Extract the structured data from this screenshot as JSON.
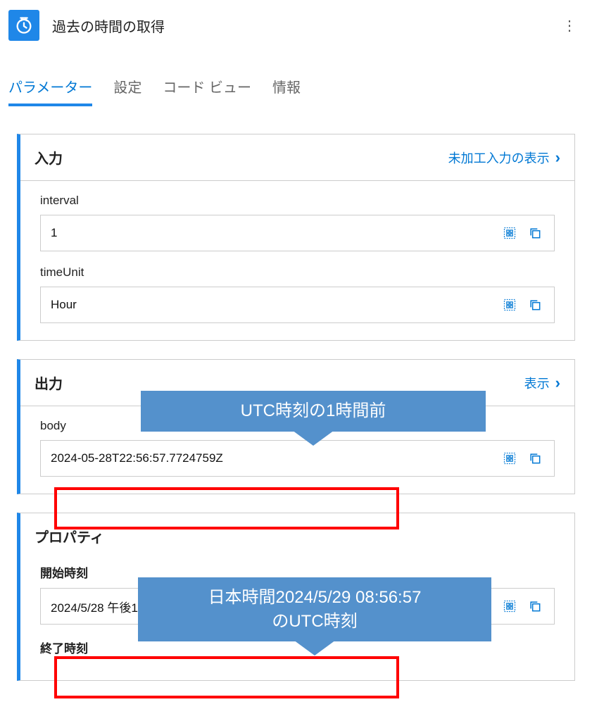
{
  "header": {
    "title": "過去の時間の取得"
  },
  "tabs": [
    {
      "label": "パラメーター",
      "active": true
    },
    {
      "label": "設定",
      "active": false
    },
    {
      "label": "コード ビュー",
      "active": false
    },
    {
      "label": "情報",
      "active": false
    }
  ],
  "cards": {
    "input": {
      "title": "入力",
      "rawLink": "未加工入力の表示",
      "fields": [
        {
          "label": "interval",
          "value": "1"
        },
        {
          "label": "timeUnit",
          "value": "Hour"
        }
      ]
    },
    "output": {
      "title": "出力",
      "rawLinkSuffix": "表示",
      "fields": [
        {
          "label": "body",
          "value": "2024-05-28T22:56:57.7724759Z"
        }
      ]
    },
    "property": {
      "title": "プロパティ",
      "fields": [
        {
          "label": "開始時刻",
          "value": "2024/5/28 午後11:56:57"
        },
        {
          "label": "終了時刻",
          "value": ""
        }
      ]
    }
  },
  "annotations": {
    "callout1": "UTC時刻の1時間前",
    "callout2": "日本時間2024/5/29 08:56:57\nのUTC時刻"
  }
}
